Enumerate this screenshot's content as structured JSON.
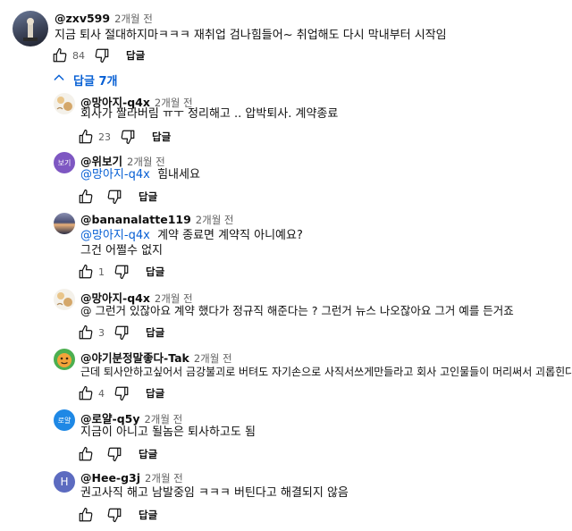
{
  "top_comment": {
    "author": "@zxv599",
    "time": "2개월 전",
    "text": "지금 퇴사 절대하지마ㅋㅋㅋ 재취업 검나힘들어~ 취업해도 다시 막내부터 시작임",
    "likes": "84",
    "reply_label": "답글"
  },
  "replies_toggle": {
    "label": "답글 7개"
  },
  "replies": [
    {
      "author": "@망아지-q4x",
      "time": "2개월 전",
      "text": "회사가 짤라버림 ㅠㅜ 정리해고 .. 압박퇴사. 계약종료",
      "likes": "23",
      "reply_label": "답글"
    },
    {
      "author": "@위보기",
      "time": "2개월 전",
      "mention": "@망아지-q4x",
      "text": "힘내세요",
      "avatar_label": "보기",
      "reply_label": "답글"
    },
    {
      "author": "@bananalatte119",
      "time": "2개월 전",
      "mention": "@망아지-q4x",
      "text": "계약 종료면 계약직 아니예요?",
      "text2": "그건 어쩔수 없지",
      "likes": "1",
      "reply_label": "답글"
    },
    {
      "author": "@망아지-q4x",
      "time": "2개월 전",
      "text": "@  그런거 있잖아요 계약 했다가 정규직 해준다는 ? 그런거 뉴스 나오잖아요 그거 예를 든거죠",
      "likes": "3",
      "reply_label": "답글"
    },
    {
      "author": "@야기분정말좋다-Tak",
      "time": "2개월 전",
      "text": "근데 퇴사안하고싶어서 금강불괴로 버텨도 자기손으로 사직서쓰게만들라고 회사 고인물들이 머리써서 괴롭힌다",
      "likes": "4",
      "reply_label": "답글"
    },
    {
      "author": "@로얄-q5y",
      "time": "2개월 전",
      "text": "지금이 아니고 될놈은 퇴사하고도 됨",
      "avatar_label": "로얄",
      "reply_label": "답글"
    },
    {
      "author": "@Hee-g3j",
      "time": "2개월 전",
      "text": "권고사직 해고 남발중임 ㅋㅋㅋ 버틴다고 해결되지 않음",
      "avatar_label": "H",
      "reply_label": "답글"
    }
  ],
  "colors": {
    "link": "#065fd4",
    "meta": "#606060",
    "avatar_purple": "#7e57c2",
    "avatar_blue": "#1e88e5",
    "avatar_indigo": "#5c6bc0"
  },
  "icons": [
    "like-icon",
    "dislike-icon",
    "chevron-up-icon"
  ]
}
